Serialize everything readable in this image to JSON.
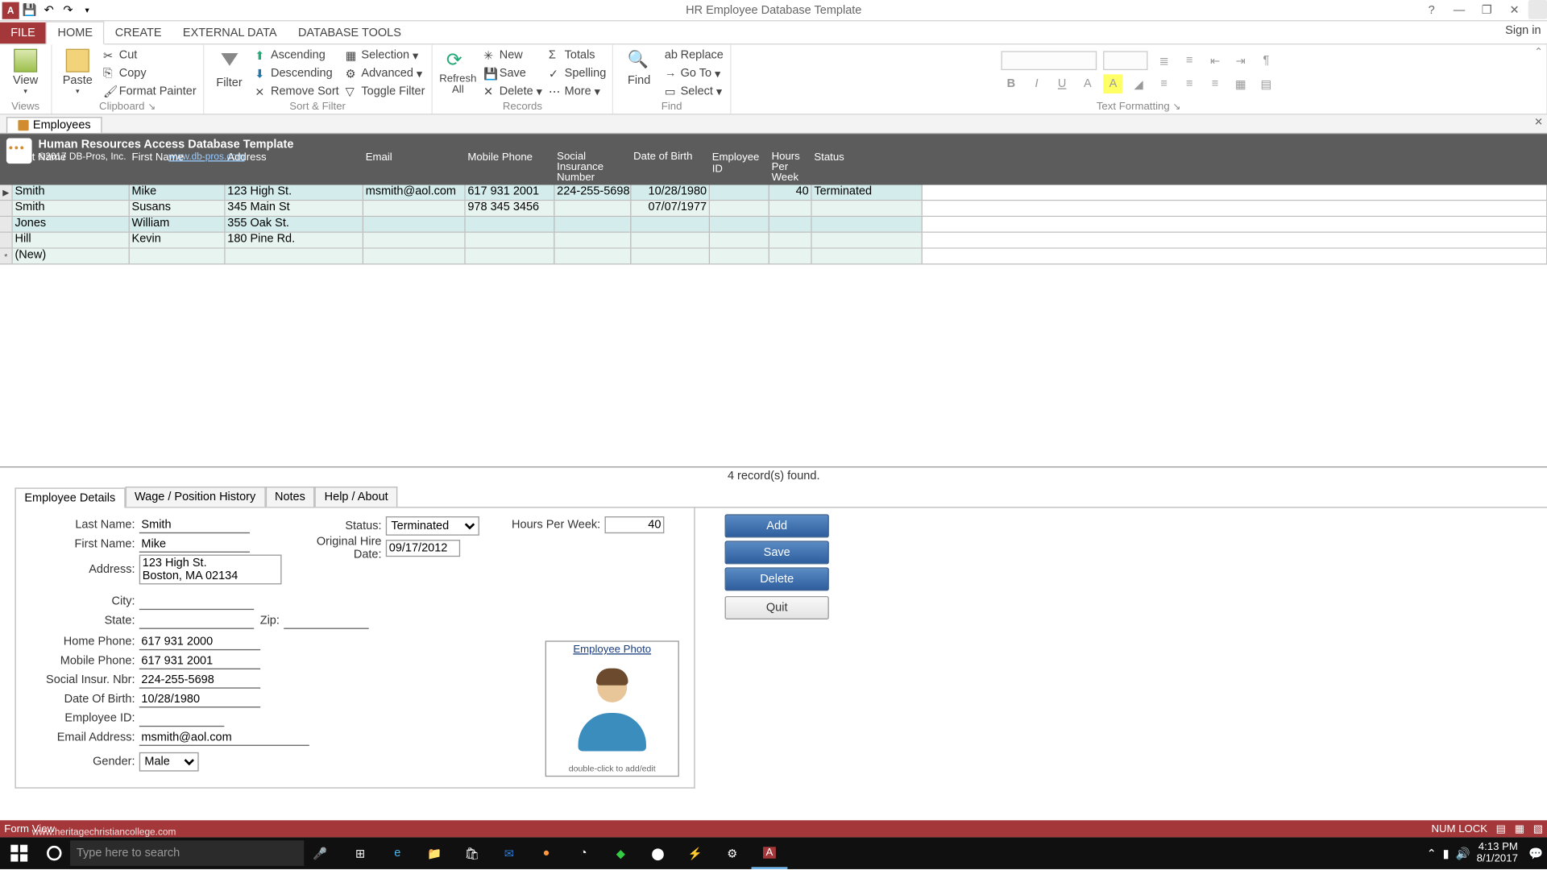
{
  "app": {
    "title": "HR Employee Database Template",
    "signin": "Sign in"
  },
  "ribbon_tabs": {
    "file": "FILE",
    "home": "HOME",
    "create": "CREATE",
    "external": "EXTERNAL DATA",
    "tools": "DATABASE TOOLS"
  },
  "ribbon": {
    "views": {
      "view": "View",
      "label": "Views"
    },
    "clipboard": {
      "paste": "Paste",
      "cut": "Cut",
      "copy": "Copy",
      "painter": "Format Painter",
      "label": "Clipboard"
    },
    "sortfilter": {
      "filter": "Filter",
      "asc": "Ascending",
      "desc": "Descending",
      "remove": "Remove Sort",
      "selection": "Selection",
      "advanced": "Advanced",
      "toggle": "Toggle Filter",
      "label": "Sort & Filter"
    },
    "records": {
      "refresh": "Refresh All",
      "new": "New",
      "save": "Save",
      "delete": "Delete",
      "totals": "Totals",
      "spelling": "Spelling",
      "more": "More",
      "label": "Records"
    },
    "find": {
      "find": "Find",
      "replace": "Replace",
      "goto": "Go To",
      "select": "Select",
      "label": "Find"
    },
    "textfmt": {
      "label": "Text Formatting"
    }
  },
  "doctab": "Employees",
  "formheader": {
    "title": "Human Resources Access Database Template",
    "copyright": "©2017 DB-Pros, Inc.",
    "link": "www.db-pros.com"
  },
  "columns": {
    "last_name": "Last Name",
    "first_name": "First Name",
    "address": "Address",
    "email": "Email",
    "mobile": "Mobile Phone",
    "sin": "Social Insurance Number",
    "dob": "Date of Birth",
    "empid": "Employee ID",
    "hpw": "Hours Per Week",
    "status": "Status"
  },
  "rows": [
    {
      "last_name": "Smith",
      "first_name": "Mike",
      "address": "123 High St.",
      "email": "msmith@aol.com",
      "mobile": "617 931 2001",
      "sin": "224-255-5698",
      "dob": "10/28/1980",
      "empid": "",
      "hpw": "40",
      "status": "Terminated"
    },
    {
      "last_name": "Smith",
      "first_name": "Susans",
      "address": "345 Main St",
      "email": "",
      "mobile": "978 345 3456",
      "sin": "",
      "dob": "07/07/1977",
      "empid": "",
      "hpw": "",
      "status": ""
    },
    {
      "last_name": "Jones",
      "first_name": "William",
      "address": "355 Oak St.",
      "email": "",
      "mobile": "",
      "sin": "",
      "dob": "",
      "empid": "",
      "hpw": "",
      "status": ""
    },
    {
      "last_name": "Hill",
      "first_name": "Kevin",
      "address": "180 Pine Rd.",
      "email": "",
      "mobile": "",
      "sin": "",
      "dob": "",
      "empid": "",
      "hpw": "",
      "status": ""
    }
  ],
  "newrow": "(New)",
  "records_found": "4 record(s) found.",
  "detail_tabs": {
    "details": "Employee Details",
    "wage": "Wage / Position History",
    "notes": "Notes",
    "help": "Help / About"
  },
  "detail_labels": {
    "last_name": "Last Name:",
    "first_name": "First Name:",
    "address": "Address:",
    "city": "City:",
    "state": "State:",
    "zip": "Zip:",
    "home_phone": "Home Phone:",
    "mobile_phone": "Mobile Phone:",
    "sin": "Social Insur. Nbr:",
    "dob": "Date Of Birth:",
    "empid": "Employee ID:",
    "email": "Email Address:",
    "gender": "Gender:",
    "status": "Status:",
    "hire_date": "Original Hire Date:",
    "hpw": "Hours Per Week:",
    "photo": "Employee Photo",
    "photo_note": "double-click to add/edit"
  },
  "detail_values": {
    "last_name": "Smith",
    "first_name": "Mike",
    "address": "123 High St.\nBoston, MA 02134",
    "city": "",
    "state": "",
    "zip": "",
    "home_phone": "617 931 2000",
    "mobile_phone": "617 931 2001",
    "sin": "224-255-5698",
    "dob": "10/28/1980",
    "empid": "",
    "email": "msmith@aol.com",
    "gender": "Male",
    "status": "Terminated",
    "hire_date": "09/17/2012",
    "hpw": "40"
  },
  "actions": {
    "add": "Add",
    "save": "Save",
    "delete": "Delete",
    "quit": "Quit"
  },
  "statusbar": {
    "left": "Form View",
    "numlock": "NUM LOCK",
    "watermark": "www.heritagechristiancollege.com"
  },
  "taskbar": {
    "search_placeholder": "Type here to search",
    "time": "4:13 PM",
    "date": "8/1/2017"
  }
}
